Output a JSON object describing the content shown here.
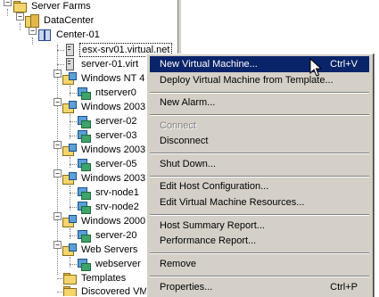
{
  "tree": {
    "nodes": [
      {
        "label": "Server Farms"
      },
      {
        "label": "DataCenter"
      },
      {
        "label": "Center-01"
      },
      {
        "label": "esx-srv01.virtual.net"
      },
      {
        "label": "server-01.virt"
      },
      {
        "label": "Windows NT 4"
      },
      {
        "label": "ntserver0"
      },
      {
        "label": "Windows 2003"
      },
      {
        "label": "server-02"
      },
      {
        "label": "server-03"
      },
      {
        "label": "Windows 2003"
      },
      {
        "label": "server-05"
      },
      {
        "label": "Windows 2003"
      },
      {
        "label": "srv-node1"
      },
      {
        "label": "srv-node2"
      },
      {
        "label": "Windows 2000"
      },
      {
        "label": "server-20"
      },
      {
        "label": "Web Servers"
      },
      {
        "label": "webserver"
      },
      {
        "label": "Templates"
      },
      {
        "label": "Discovered VM"
      }
    ]
  },
  "context_menu": {
    "items": [
      {
        "label": "New Virtual Machine...",
        "shortcut": "Ctrl+V",
        "highlighted": true
      },
      {
        "label": "Deploy Virtual Machine from Template..."
      },
      {
        "label": "New Alarm..."
      },
      {
        "label": "Connect",
        "disabled": true
      },
      {
        "label": "Disconnect"
      },
      {
        "label": "Shut Down..."
      },
      {
        "label": "Edit Host Configuration..."
      },
      {
        "label": "Edit Virtual Machine Resources..."
      },
      {
        "label": "Host Summary Report..."
      },
      {
        "label": "Performance Report..."
      },
      {
        "label": "Remove"
      },
      {
        "label": "Properties...",
        "shortcut": "Ctrl+P"
      }
    ]
  },
  "colors": {
    "menu_background": "#d4d0c8",
    "menu_highlight": "#0a246a",
    "folder": "#f3d56b"
  }
}
